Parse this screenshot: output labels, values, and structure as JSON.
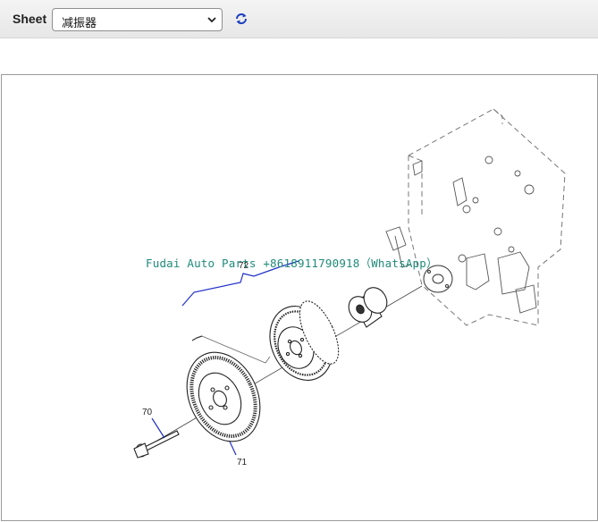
{
  "toolbar": {
    "sheet_label": "Sheet",
    "sheet_value": "减振器",
    "refresh_icon": "refresh-icon"
  },
  "diagram": {
    "watermark": "Fudai Auto Parts +8618911790918（WhatsApp）",
    "callouts": [
      "72",
      "70",
      "71"
    ],
    "callout_color": "#2230c8"
  }
}
